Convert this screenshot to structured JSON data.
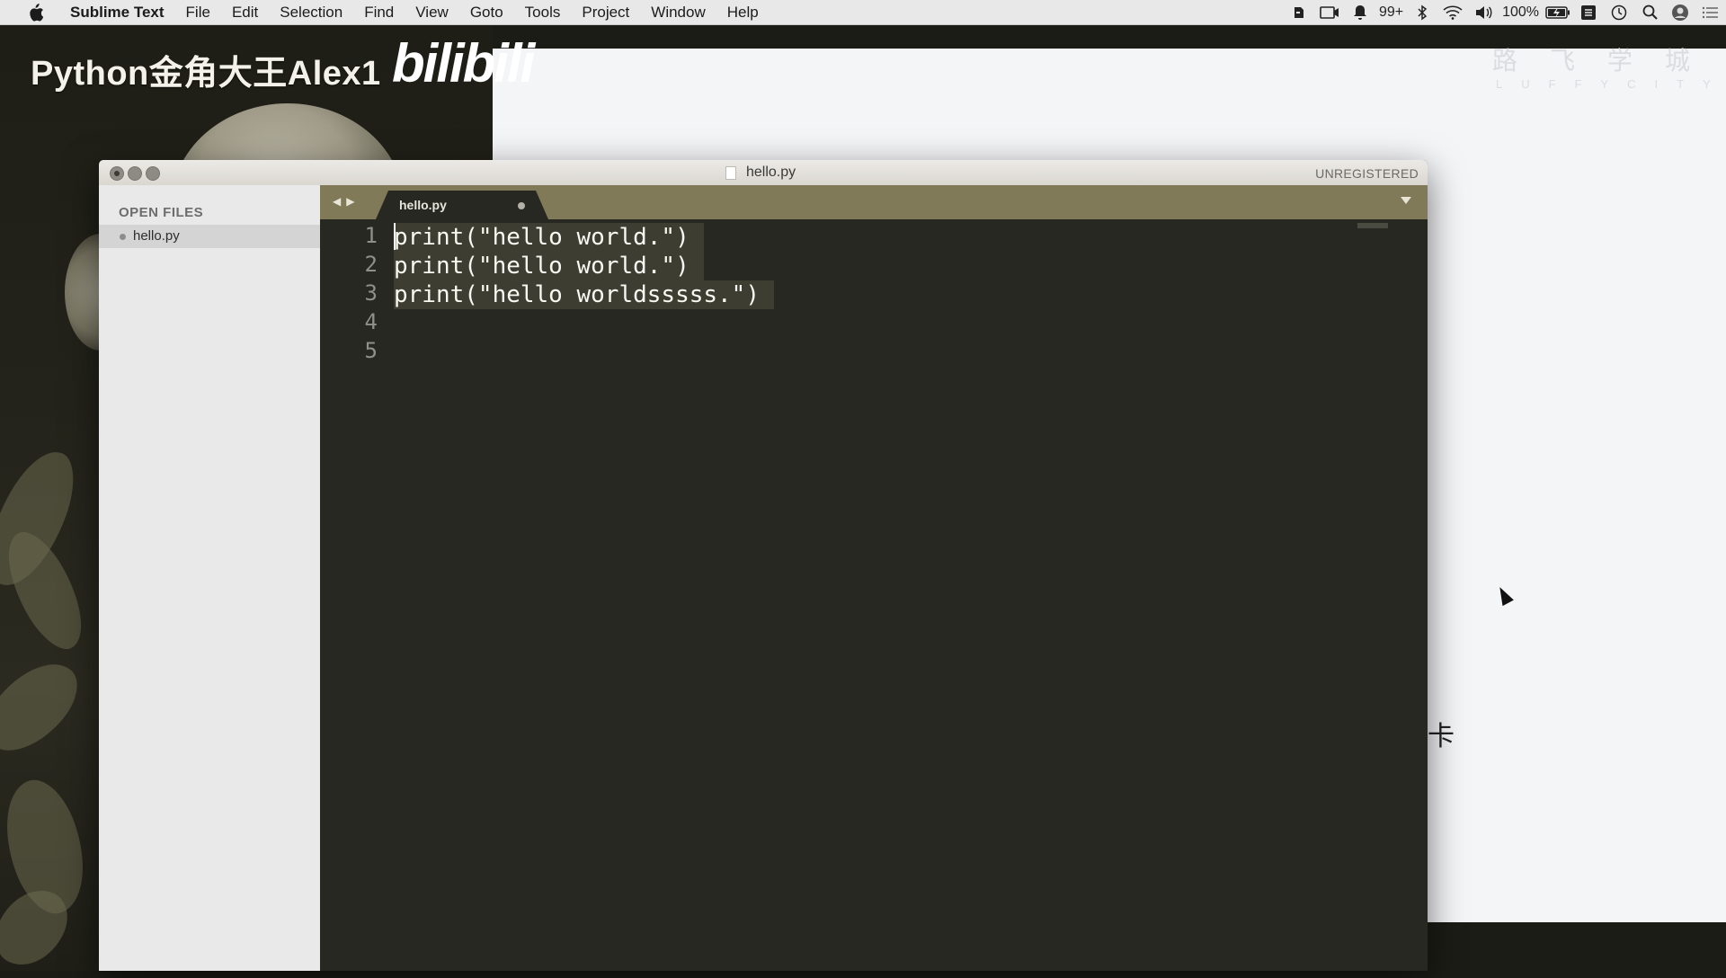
{
  "menubar": {
    "app_name": "Sublime Text",
    "items": [
      "File",
      "Edit",
      "Selection",
      "Find",
      "View",
      "Goto",
      "Tools",
      "Project",
      "Window",
      "Help"
    ],
    "notifications": "99+",
    "battery": "100%"
  },
  "background": {
    "watermark_title": "Python金角大王Alex1",
    "watermark_logo": "bilibili",
    "luffy_cn": "路飞学城",
    "luffy_en": "LUFFYCITY",
    "side_char": "卡"
  },
  "window": {
    "title": "hello.py",
    "unregistered": "UNREGISTERED",
    "sidebar": {
      "header": "OPEN FILES",
      "files": [
        "hello.py"
      ]
    },
    "tabs": [
      {
        "label": "hello.py",
        "dirty": true
      }
    ],
    "editor": {
      "lines": [
        "print(\"hello world.\")",
        "print(\"hello world.\")",
        "print(\"hello worldsssss.\")",
        "",
        ""
      ],
      "line_numbers": [
        "1",
        "2",
        "3",
        "4",
        "5"
      ]
    }
  },
  "colors": {
    "editor_bg": "#272822",
    "tabbar_bg": "#807a59",
    "selection": "#3e3d32"
  }
}
